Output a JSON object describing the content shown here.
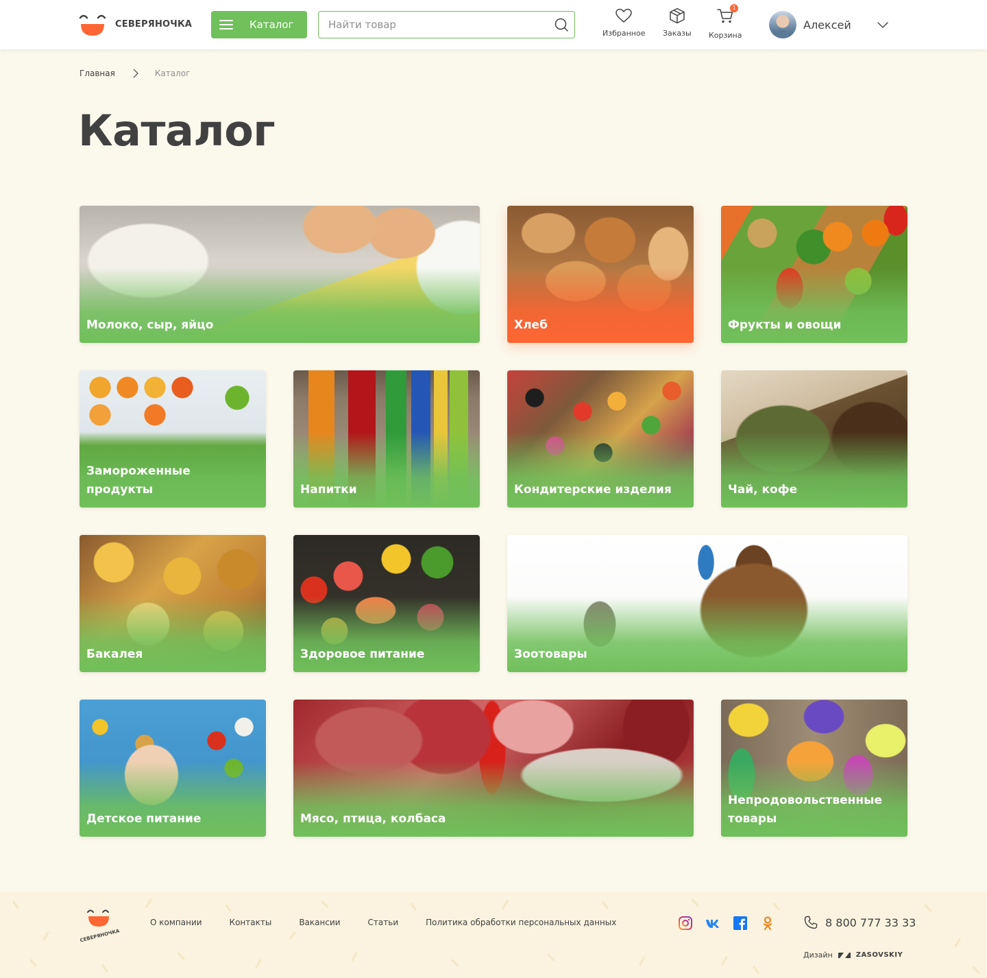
{
  "header": {
    "brand": "СЕВЕРЯНОЧКА",
    "catalog_button": "Каталог",
    "search_placeholder": "Найти товар",
    "favorites_label": "Избранное",
    "orders_label": "Заказы",
    "cart_label": "Корзина",
    "cart_count": "1",
    "user_name": "Алексей"
  },
  "breadcrumb": {
    "home": "Главная",
    "current": "Каталог"
  },
  "page_title": "Каталог",
  "categories": [
    {
      "label": "Молоко, сыр, яйцо",
      "highlight": false
    },
    {
      "label": "Хлеб",
      "highlight": true
    },
    {
      "label": "Фрукты и овощи",
      "highlight": false
    },
    {
      "label": "Замороженные продукты",
      "highlight": false
    },
    {
      "label": "Напитки",
      "highlight": false
    },
    {
      "label": "Кондитерские изделия",
      "highlight": false
    },
    {
      "label": "Чай, кофе",
      "highlight": false
    },
    {
      "label": "Бакалея",
      "highlight": false
    },
    {
      "label": "Здоровое питание",
      "highlight": false
    },
    {
      "label": "Зоотовары",
      "highlight": false
    },
    {
      "label": "Детское питание",
      "highlight": false
    },
    {
      "label": "Мясо, птица, колбаса",
      "highlight": false
    },
    {
      "label": "Непродовольственные товары",
      "highlight": false
    }
  ],
  "footer": {
    "brand": "СЕВЕРЯНОЧКА",
    "links": [
      "О компании",
      "Контакты",
      "Вакансии",
      "Статьи",
      "Политика обработки персональных данных"
    ],
    "phone": "8 800 777 33 33",
    "design_label": "Дизайн",
    "design_studio": "ZASOVSKIY"
  },
  "colors": {
    "accent_green": "#70c05b",
    "accent_orange": "#ff6633",
    "text": "#414141",
    "background": "#fbf8ec"
  },
  "icons": [
    "menu-icon",
    "search-icon",
    "heart-icon",
    "box-icon",
    "cart-icon",
    "chevron-down-icon",
    "chevron-right-icon",
    "instagram-icon",
    "vk-icon",
    "facebook-icon",
    "odnoklassniki-icon",
    "phone-icon"
  ]
}
